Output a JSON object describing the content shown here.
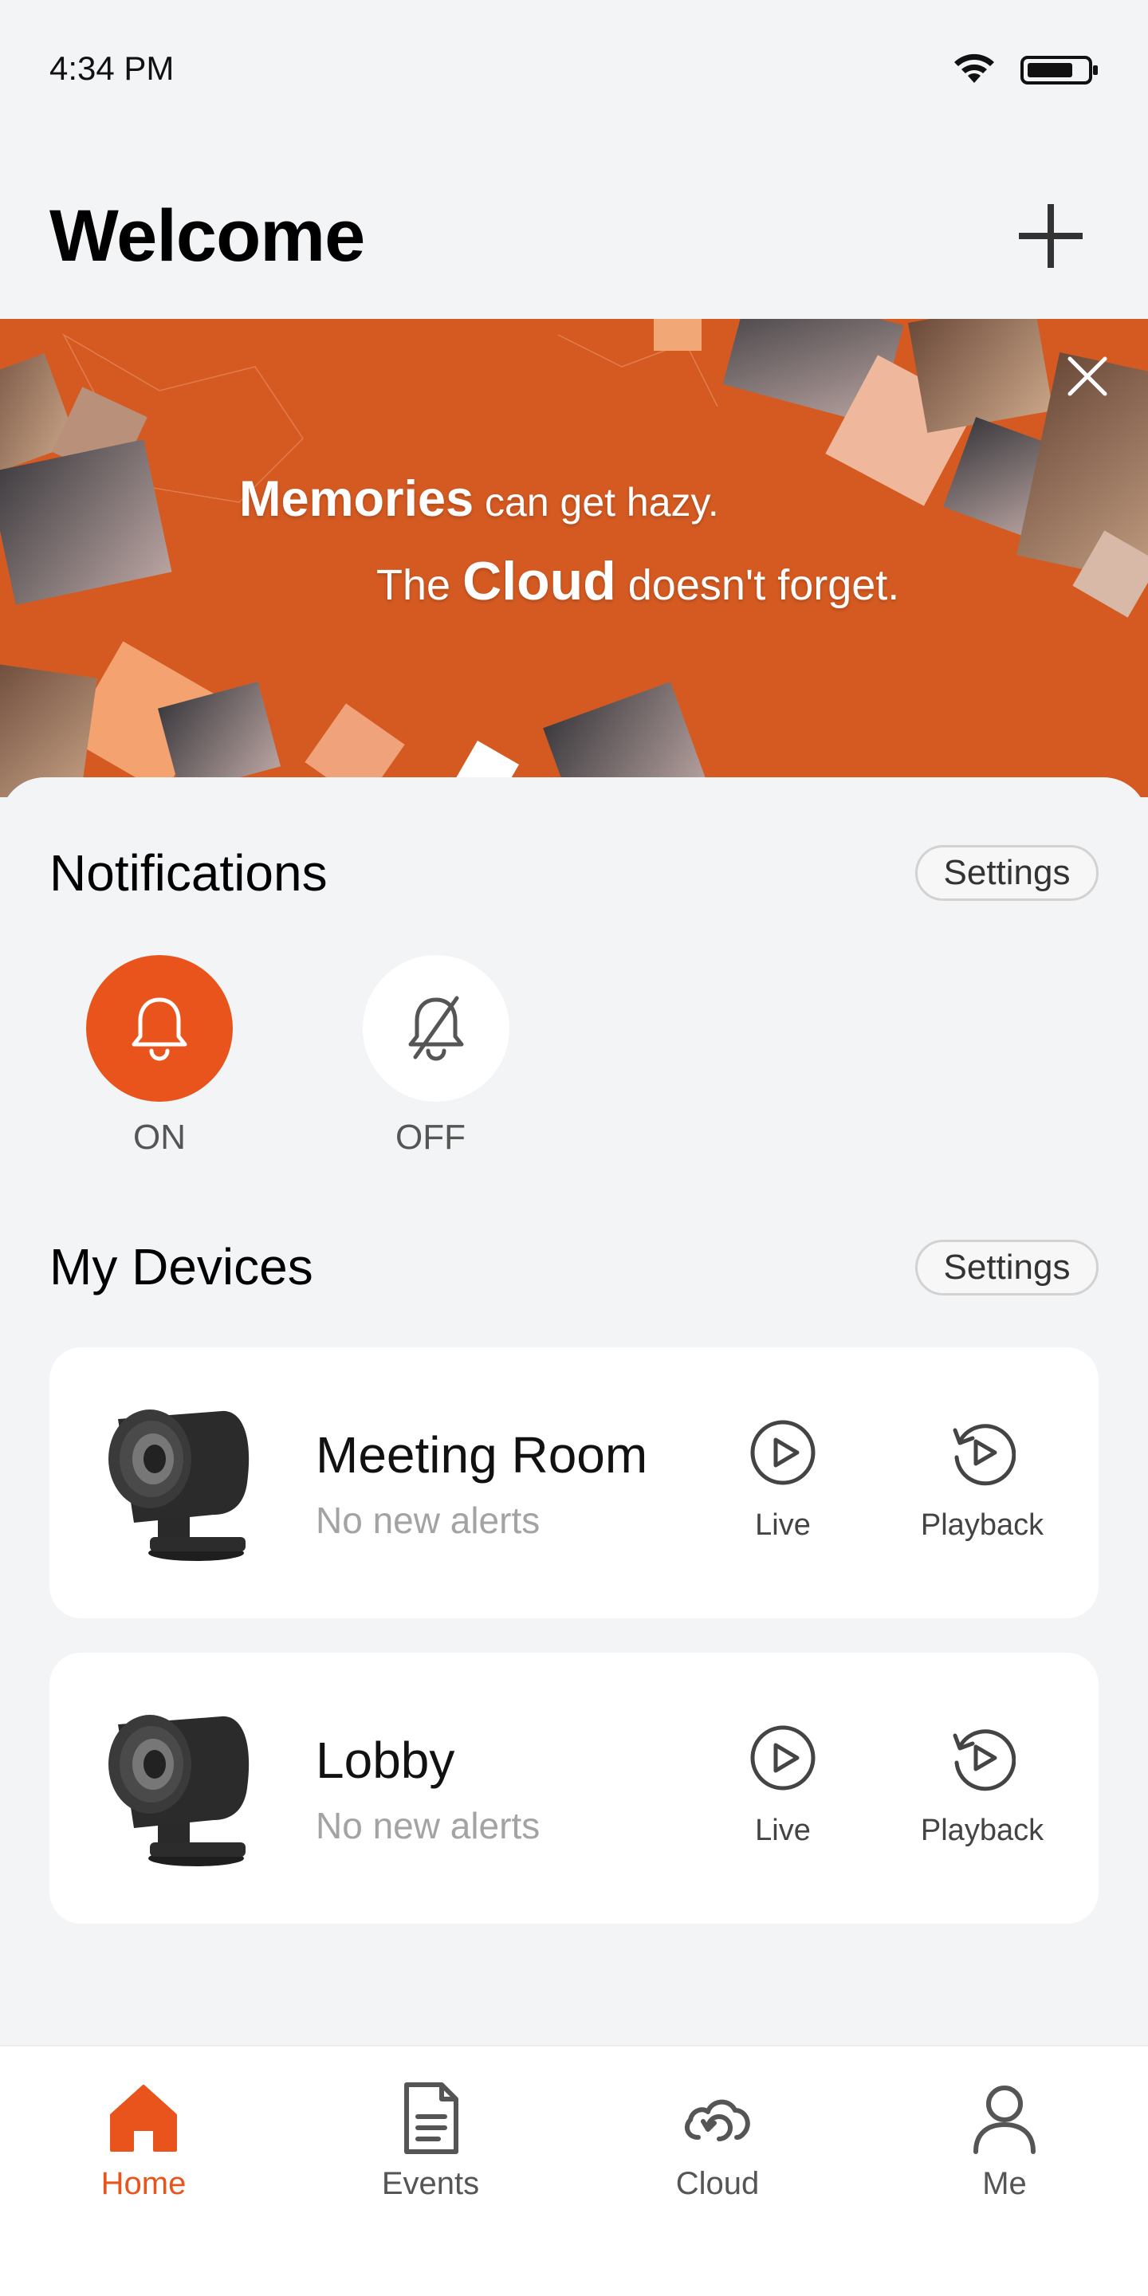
{
  "status_bar": {
    "time": "4:34 PM"
  },
  "header": {
    "title": "Welcome"
  },
  "banner": {
    "line1_strong": "Memories",
    "line1_rest": " can get hazy.",
    "line2_pre": "The ",
    "line2_strong": "Cloud",
    "line2_rest": " doesn't forget."
  },
  "notifications": {
    "title": "Notifications",
    "settings_label": "Settings",
    "on_label": "ON",
    "off_label": "OFF"
  },
  "devices": {
    "title": "My Devices",
    "settings_label": "Settings",
    "items": [
      {
        "name": "Meeting Room",
        "status": "No new alerts",
        "live_label": "Live",
        "playback_label": "Playback"
      },
      {
        "name": "Lobby",
        "status": "No new alerts",
        "live_label": "Live",
        "playback_label": "Playback"
      }
    ]
  },
  "tabbar": {
    "items": [
      {
        "label": "Home",
        "icon": "home-icon",
        "active": true
      },
      {
        "label": "Events",
        "icon": "document-icon",
        "active": false
      },
      {
        "label": "Cloud",
        "icon": "cloud-icon",
        "active": false
      },
      {
        "label": "Me",
        "icon": "person-icon",
        "active": false
      }
    ]
  },
  "colors": {
    "accent": "#e8541b",
    "banner": "#d45a22",
    "background": "#f3f4f6"
  }
}
